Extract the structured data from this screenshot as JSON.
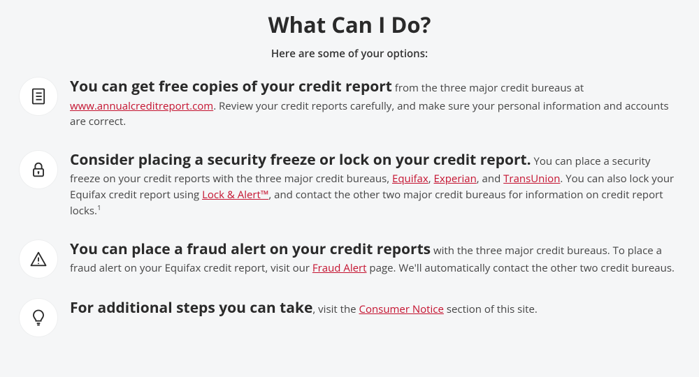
{
  "title": "What Can I Do?",
  "subtitle": "Here are some of your options:",
  "items": [
    {
      "lead": "You can get free copies of your credit report",
      "seg1": " from the three major credit bureaus at ",
      "link1": "www.annualcreditreport.com",
      "seg2": ". Review your credit reports carefully, and make sure your personal information and accounts are correct."
    },
    {
      "lead": "Consider placing a security freeze or lock on your credit report.",
      "seg1": " You can place a security freeze on your credit reports with the three major credit bureaus, ",
      "link1": "Equifax",
      "seg2": ", ",
      "link2": "Experian",
      "seg3": ", and ",
      "link3": "TransUnion",
      "seg4": ". You can also lock your Equifax credit report using ",
      "link4": "Lock & Alert™",
      "seg5": ", and contact the other two major credit bureaus for information on credit report locks.",
      "sup": "1"
    },
    {
      "lead": "You can place a fraud alert on your credit reports",
      "seg1": " with the three major credit bureaus. To place a fraud alert on your Equifax credit report, visit our ",
      "link1": "Fraud Alert",
      "seg2": " page. We'll automatically contact the other two credit bureaus."
    },
    {
      "lead": "For additional steps you can take",
      "seg1": ", visit the ",
      "link1": "Consumer Notice",
      "seg2": " section of this site."
    }
  ]
}
